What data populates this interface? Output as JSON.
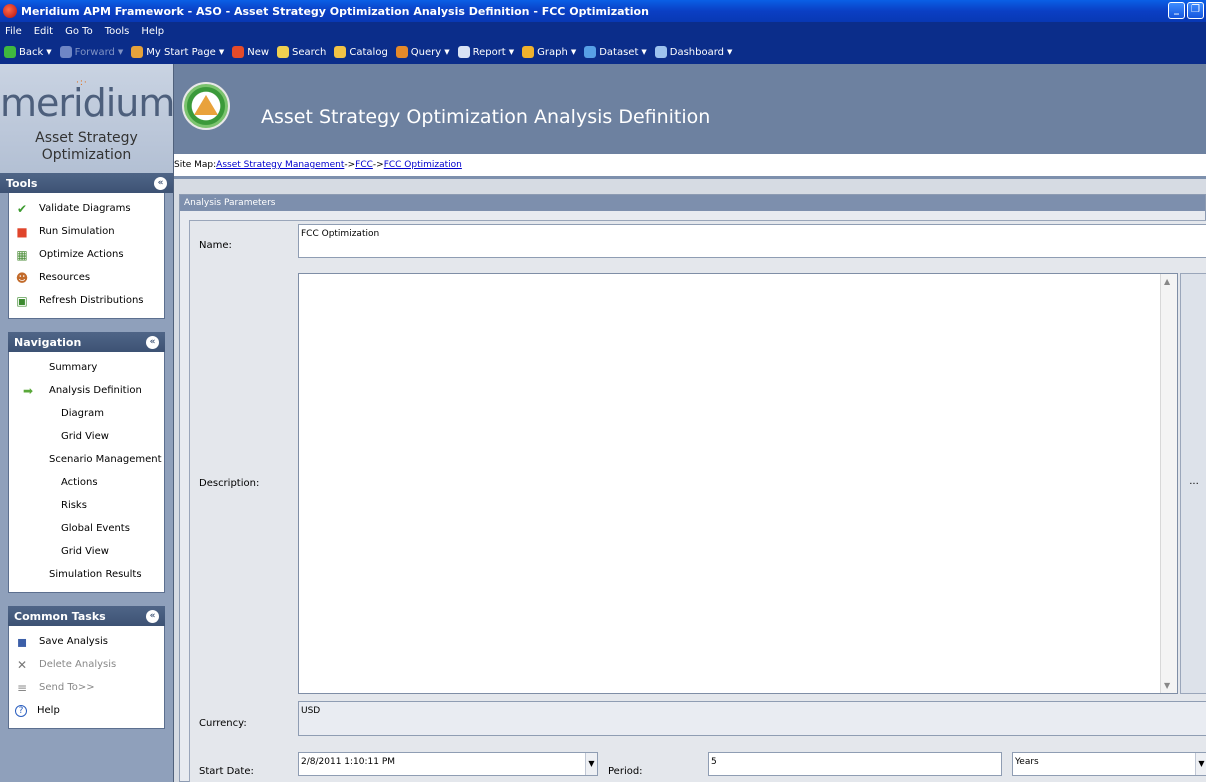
{
  "window": {
    "title": "Meridium APM Framework - ASO - Asset Strategy Optimization Analysis Definition - FCC Optimization",
    "min_glyph": "_",
    "max_glyph": "❐"
  },
  "menu": [
    "File",
    "Edit",
    "Go To",
    "Tools",
    "Help"
  ],
  "toolbar": [
    {
      "label": "Back",
      "icon": "back-arrow-icon",
      "color": "#3fb83f",
      "dropdown": true,
      "disabled": false
    },
    {
      "label": "Forward",
      "icon": "forward-arrow-icon",
      "color": "#6f86c5",
      "dropdown": true,
      "disabled": true
    },
    {
      "label": "My Start Page",
      "icon": "home-icon",
      "color": "#e5a23b",
      "dropdown": true,
      "disabled": false
    },
    {
      "label": "New",
      "icon": "new-icon",
      "color": "#e54b2a",
      "dropdown": false,
      "disabled": false
    },
    {
      "label": "Search",
      "icon": "search-icon",
      "color": "#f0d050",
      "dropdown": false,
      "disabled": false
    },
    {
      "label": "Catalog",
      "icon": "folder-icon",
      "color": "#f2c246",
      "dropdown": false,
      "disabled": false
    },
    {
      "label": "Query",
      "icon": "query-icon",
      "color": "#e58a2a",
      "dropdown": true,
      "disabled": false
    },
    {
      "label": "Report",
      "icon": "report-icon",
      "color": "#d9e3f5",
      "dropdown": true,
      "disabled": false
    },
    {
      "label": "Graph",
      "icon": "graph-icon",
      "color": "#f0b22d",
      "dropdown": true,
      "disabled": false
    },
    {
      "label": "Dataset",
      "icon": "dataset-icon",
      "color": "#57a0e6",
      "dropdown": true,
      "disabled": false
    },
    {
      "label": "Dashboard",
      "icon": "dashboard-icon",
      "color": "#9dc2ee",
      "dropdown": true,
      "disabled": false
    }
  ],
  "brand": {
    "logo": "meridium",
    "dots": "·:·",
    "subtitle_line1": "Asset Strategy",
    "subtitle_line2": "Optimization"
  },
  "tools": {
    "title": "Tools",
    "items": [
      {
        "label": "Validate Diagrams",
        "icon": "checkmark-icon"
      },
      {
        "label": "Run Simulation",
        "icon": "run-simulation-icon"
      },
      {
        "label": "Optimize Actions",
        "icon": "optimize-icon"
      },
      {
        "label": "Resources",
        "icon": "resources-icon"
      },
      {
        "label": "Refresh Distributions",
        "icon": "refresh-distributions-icon"
      }
    ]
  },
  "navigation": {
    "title": "Navigation",
    "items": [
      {
        "label": "Summary",
        "indent": 0,
        "current": false
      },
      {
        "label": "Analysis Definition",
        "indent": 0,
        "current": true
      },
      {
        "label": "Diagram",
        "indent": 1,
        "current": false
      },
      {
        "label": "Grid View",
        "indent": 1,
        "current": false
      },
      {
        "label": "Scenario Management",
        "indent": 0,
        "current": false
      },
      {
        "label": "Actions",
        "indent": 1,
        "current": false
      },
      {
        "label": "Risks",
        "indent": 1,
        "current": false
      },
      {
        "label": "Global Events",
        "indent": 1,
        "current": false
      },
      {
        "label": "Grid View",
        "indent": 1,
        "current": false
      },
      {
        "label": "Simulation Results",
        "indent": 0,
        "current": false
      }
    ]
  },
  "common_tasks": {
    "title": "Common Tasks",
    "items": [
      {
        "label": "Save Analysis",
        "icon": "save-icon",
        "disabled": false
      },
      {
        "label": "Delete Analysis",
        "icon": "delete-icon",
        "disabled": true
      },
      {
        "label": "Send To>>",
        "icon": "send-to-icon",
        "disabled": true
      },
      {
        "label": "Help",
        "icon": "help-icon",
        "disabled": false
      }
    ]
  },
  "header": {
    "title": "Asset Strategy Optimization Analysis Definition"
  },
  "sitemap": {
    "prefix": "Site Map: ",
    "links": [
      "Asset Strategy Management",
      "FCC",
      "FCC Optimization"
    ],
    "separator": "->"
  },
  "form": {
    "group_title": "Analysis Parameters",
    "name_label": "Name:",
    "name_value": "FCC Optimization",
    "description_label": "Description:",
    "description_value": "",
    "ellipsis": "...",
    "currency_label": "Currency:",
    "currency_value": "USD",
    "start_date_label": "Start Date:",
    "start_date_value": "2/8/2011 1:10:11 PM",
    "period_label": "Period:",
    "period_value": "5",
    "period_unit": "Years"
  }
}
